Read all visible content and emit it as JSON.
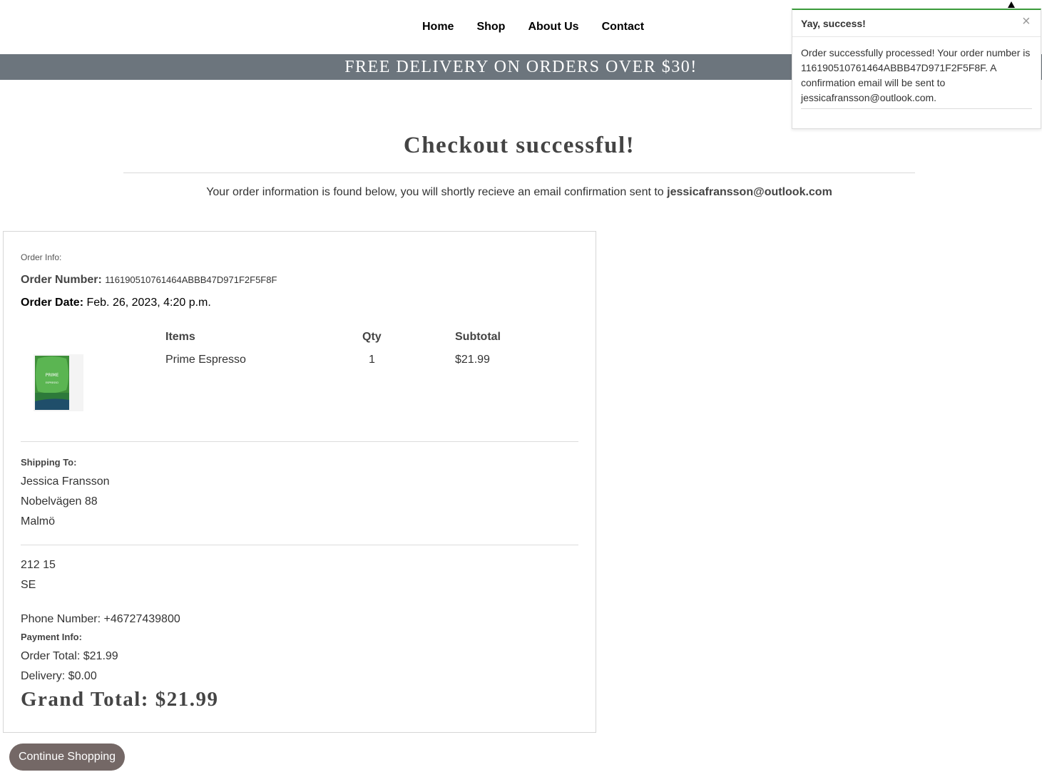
{
  "nav": {
    "items": [
      {
        "label": "Home"
      },
      {
        "label": "Shop"
      },
      {
        "label": "About Us"
      },
      {
        "label": "Contact"
      }
    ]
  },
  "banner": {
    "text": "FREE DELIVERY ON ORDERS OVER $30!"
  },
  "page": {
    "title": "Checkout successful!",
    "intro_text": "Your order information is found below, you will shortly recieve an email confirmation sent to ",
    "intro_email": "jessicafransson@outlook.com"
  },
  "order": {
    "info_label": "Order Info:",
    "number_label": "Order Number:",
    "number": "116190510761464ABBB47D971F2F5F8F",
    "date_label": "Order Date:",
    "date": "Feb. 26, 2023, 4:20 p.m.",
    "table": {
      "headers": [
        "Items",
        "Qty",
        "Subtotal"
      ],
      "rows": [
        {
          "item": "Prime Espresso",
          "qty": "1",
          "subtotal": "$21.99",
          "image_icon": "coffee-bag-icon",
          "image_text": "PRIME",
          "image_subtext": "ESPRESSO"
        }
      ]
    }
  },
  "shipping": {
    "label": "Shipping To:",
    "name": "Jessica Fransson",
    "street": "Nobelvägen 88",
    "city": "Malmö",
    "postcode": "212 15",
    "country": "SE",
    "phone": "Phone Number: +46727439800"
  },
  "payment": {
    "label": "Payment Info:",
    "order_total": "Order Total: $21.99",
    "delivery": "Delivery: $0.00",
    "grand_total": "Grand Total: $21.99"
  },
  "actions": {
    "continue_label": "Continue Shopping"
  },
  "toast": {
    "title": "Yay, success!",
    "close_icon": "×",
    "message": "Order successfully processed! Your order number is 116190510761464ABBB47D971F2F5F8F. A confirmation email will be sent to jessicafransson@outlook.com."
  },
  "colors": {
    "banner_bg": "#6c757d",
    "button_bg": "#746866",
    "toast_accent": "#3a9a3a",
    "product_green": "#4caf48"
  }
}
